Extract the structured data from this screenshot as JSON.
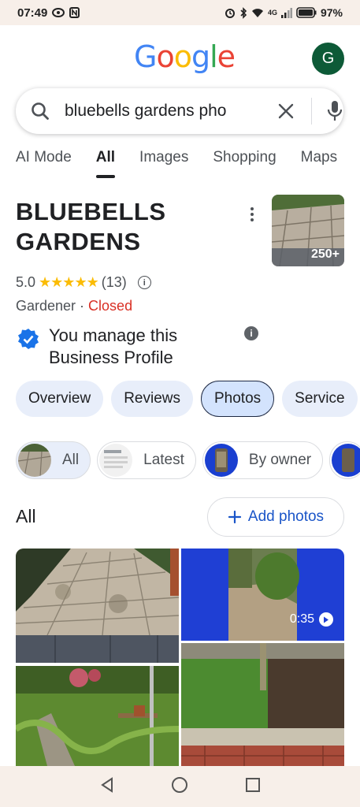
{
  "status_bar": {
    "time": "07:49",
    "network": "4G",
    "battery": "97%"
  },
  "header": {
    "logo_letters": [
      {
        "ch": "G",
        "color": "#4285f4"
      },
      {
        "ch": "o",
        "color": "#ea4335"
      },
      {
        "ch": "o",
        "color": "#fbbc05"
      },
      {
        "ch": "g",
        "color": "#4285f4"
      },
      {
        "ch": "l",
        "color": "#34a853"
      },
      {
        "ch": "e",
        "color": "#ea4335"
      }
    ],
    "avatar_initial": "G"
  },
  "search": {
    "query": "bluebells gardens pho"
  },
  "tabs": [
    {
      "label": "AI Mode",
      "active": false
    },
    {
      "label": "All",
      "active": true
    },
    {
      "label": "Images",
      "active": false
    },
    {
      "label": "Shopping",
      "active": false
    },
    {
      "label": "Maps",
      "active": false
    }
  ],
  "business": {
    "name_line1": "BLUEBELLS",
    "name_line2": "GARDENS",
    "photo_count": "250+",
    "rating": "5.0",
    "stars": "★★★★★",
    "review_count": "(13)",
    "category": "Gardener",
    "separator": " · ",
    "status": "Closed",
    "manage_line1": "You manage this",
    "manage_line2": "Business Profile"
  },
  "section_chips": [
    {
      "label": "Overview",
      "active": false
    },
    {
      "label": "Reviews",
      "active": false
    },
    {
      "label": "Photos",
      "active": true
    },
    {
      "label": "Service",
      "active": false
    }
  ],
  "photo_filters": [
    {
      "label": "All",
      "active": true
    },
    {
      "label": "Latest",
      "active": false
    },
    {
      "label": "By owner",
      "active": false
    }
  ],
  "photos_section": {
    "label": "All",
    "add_button": "Add photos",
    "video_duration": "0:35"
  },
  "colors": {
    "accent": "#1a55c8",
    "closed": "#d93025",
    "chip_bg": "#e8eefa",
    "verified": "#1a73e8"
  }
}
